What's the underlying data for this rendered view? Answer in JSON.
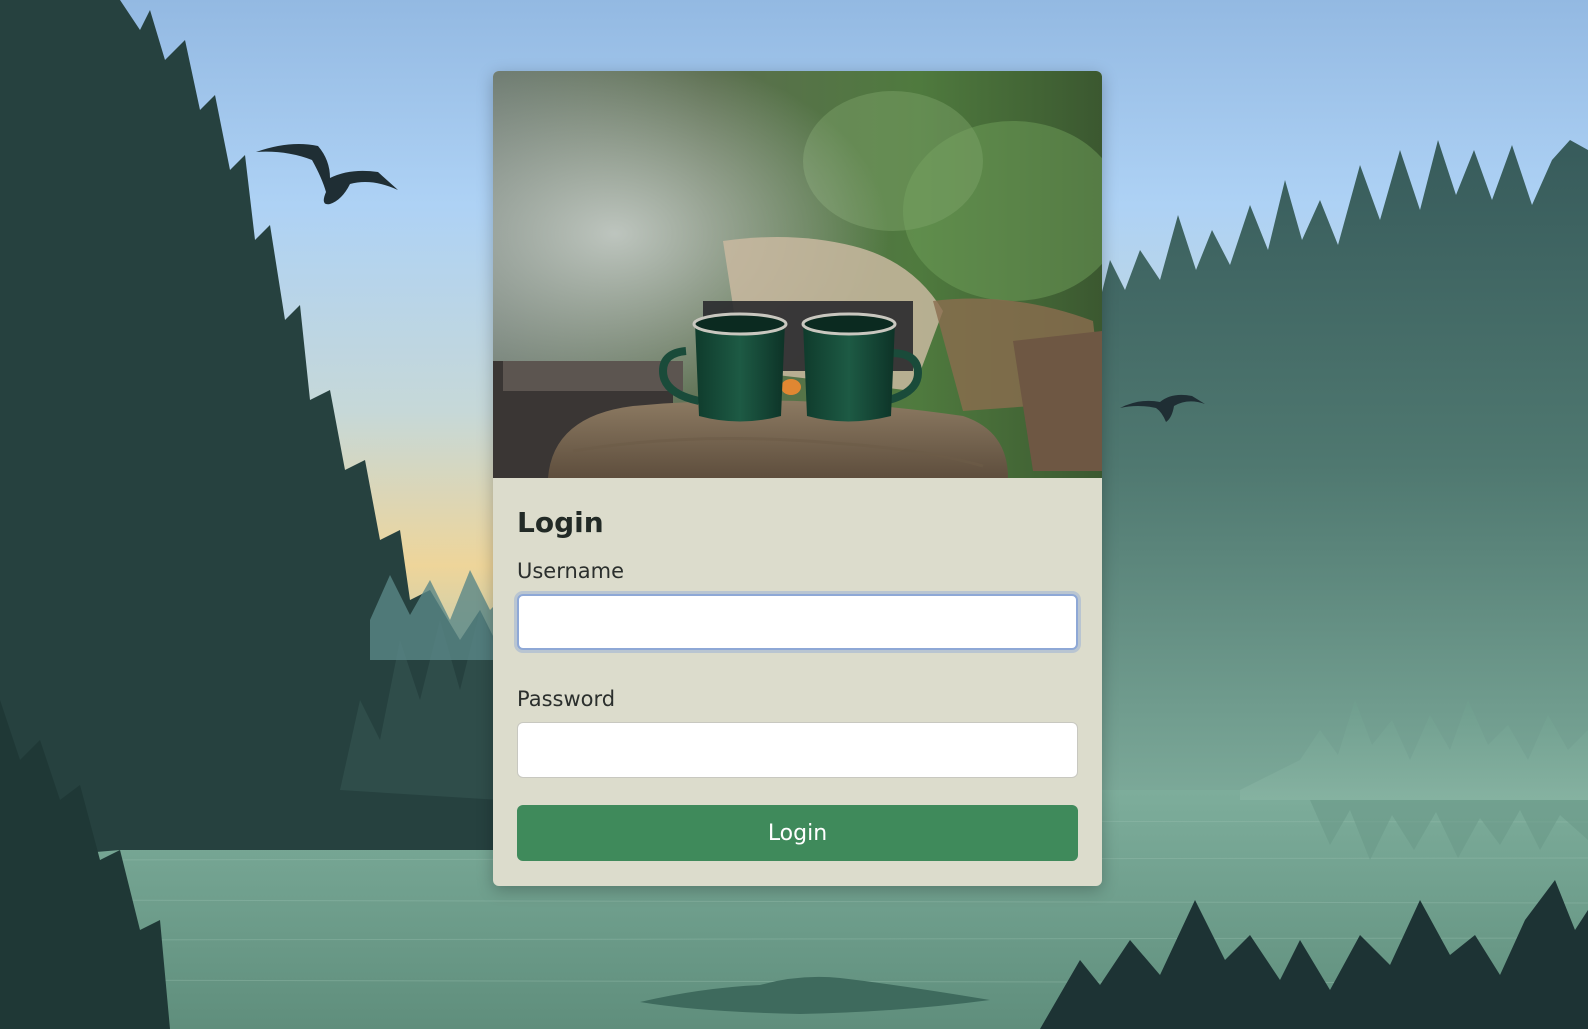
{
  "login_form": {
    "heading": "Login",
    "username_label": "Username",
    "username_value": "",
    "password_label": "Password",
    "password_value": "",
    "submit_label": "Login"
  },
  "colors": {
    "card_background": "#dcdccc",
    "button_background": "#3f8a5b",
    "button_text": "#ffffff",
    "focus_ring": "#8ea8d6"
  }
}
